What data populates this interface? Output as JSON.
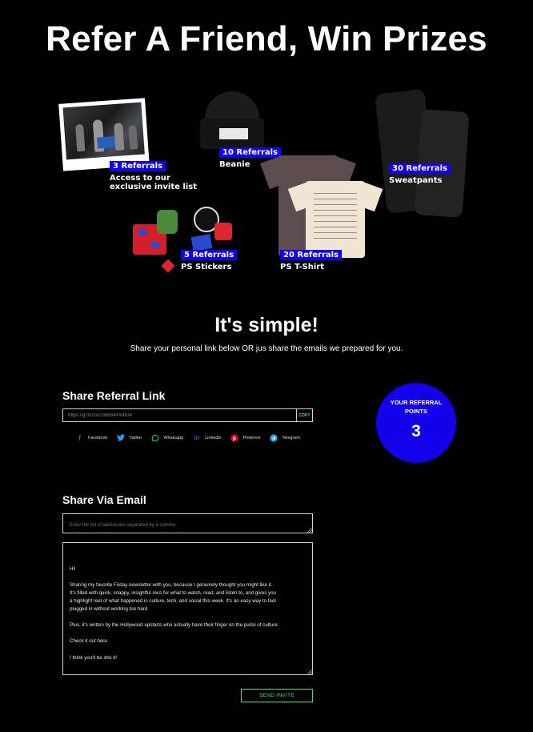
{
  "page": {
    "title": "Refer A Friend, Win Prizes"
  },
  "prizes": [
    {
      "referrals": "3 Referrals",
      "description_line1": "Access to our",
      "description_line2": "exclusive invite list"
    },
    {
      "referrals": "10 Referrals",
      "description_line1": "Beanie"
    },
    {
      "referrals": "30 Referrals",
      "description_line1": "Sweatpants"
    },
    {
      "referrals": "5 Referrals",
      "description_line1": "PS Stickers"
    },
    {
      "referrals": "20 Referrals",
      "description_line1": "PS T-Shirt"
    }
  ],
  "simple": {
    "title": "It's simple!",
    "subtitle": "Share your personal link below OR jus share the emails we prepared for you."
  },
  "referral_link": {
    "heading": "Share Referral Link",
    "url": "https://gr3f.co/c/38834/PAhO4",
    "copy_label": "COPY"
  },
  "share_options": [
    {
      "label": "Facebook",
      "icon": "facebook-icon",
      "color": "#3b5998"
    },
    {
      "label": "Twitter",
      "icon": "twitter-icon",
      "color": "#1da1f2"
    },
    {
      "label": "Whatsapp",
      "icon": "whatsapp-icon",
      "color": "#25d366"
    },
    {
      "label": "Linkedin",
      "icon": "linkedin-icon",
      "color": "#0a66c2"
    },
    {
      "label": "Pinterest",
      "icon": "pinterest-icon",
      "color": "#e60023"
    },
    {
      "label": "Telegram",
      "icon": "telegram-icon",
      "color": "#2aa3e0"
    }
  ],
  "points": {
    "label": "YOUR REFERRAL POINTS",
    "value": "3"
  },
  "email": {
    "heading": "Share Via Email",
    "addresses_placeholder": "Enter the list of addresses separated by a comma",
    "message": "Hi!\n\nSharing my favorite Friday newsletter with you, because I genuinely thought you might like it.\nIt's filled with quick, snappy, insightful recs for what to watch, read, and listen to, and gives you\na highlight reel of what happened in culture, tech, and social this week. It's an easy way to feel\nplugged in without working too hard.\n\nPlus, it's written by the Hollywood upstarts who actually have their finger on the pulse of culture.\n\nCheck it out here.\n\nI think you'll be into it!",
    "send_label": "SEND INVITE"
  },
  "colors": {
    "background": "#000000",
    "accent_blue": "#1300e8",
    "accent_green": "#3fe08a"
  }
}
